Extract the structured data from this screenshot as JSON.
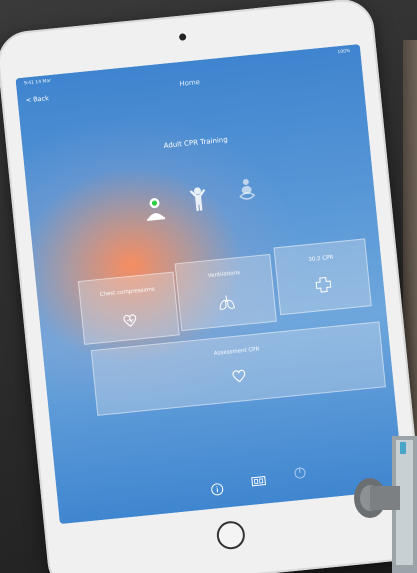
{
  "status_bar": {
    "left": "9:41 14 Mar",
    "right": "100%"
  },
  "nav": {
    "back_label": "< Back",
    "title": "Home"
  },
  "page_title": "Adult CPR Training",
  "figures": [
    {
      "name": "adult",
      "icon": "adult-head-icon",
      "selected": true
    },
    {
      "name": "child",
      "icon": "child-figure-icon",
      "selected": false
    },
    {
      "name": "infant",
      "icon": "infant-figure-icon",
      "selected": false
    }
  ],
  "tiles": [
    {
      "label": "Chest compressions",
      "icon": "heart-hands-icon"
    },
    {
      "label": "Ventilations",
      "icon": "lungs-icon"
    },
    {
      "label": "30:2 CPR",
      "icon": "cross-icon"
    },
    {
      "label": "Assessment CPR",
      "icon": "heart-icon"
    }
  ],
  "tab_bar": [
    {
      "name": "info",
      "icon": "info-icon"
    },
    {
      "name": "device",
      "icon": "device-icon"
    },
    {
      "name": "power",
      "icon": "power-icon"
    }
  ],
  "colors": {
    "screen_top": "#3f84cf",
    "glow": "#ff8c5a",
    "tile_bg": "rgba(235,235,240,0.30)",
    "selected_dot": "#2ecc40"
  }
}
